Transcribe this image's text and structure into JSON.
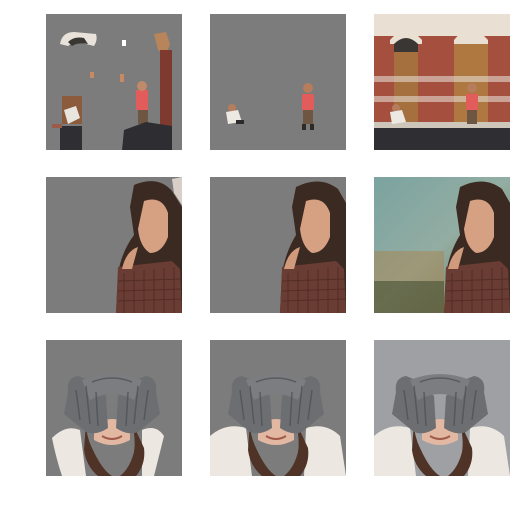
{
  "figure": {
    "rows": [
      {
        "subject": "children-and-doorways",
        "panels": [
          {
            "kind": "partial-segmentation-mask"
          },
          {
            "kind": "refined-segmentation-mask"
          },
          {
            "kind": "original-photo"
          }
        ]
      },
      {
        "subject": "woman-in-plaid-dress",
        "panels": [
          {
            "kind": "partial-segmentation-mask"
          },
          {
            "kind": "refined-segmentation-mask"
          },
          {
            "kind": "original-photo"
          }
        ]
      },
      {
        "subject": "girl-covering-eyes-with-mittens",
        "panels": [
          {
            "kind": "partial-segmentation-mask"
          },
          {
            "kind": "refined-segmentation-mask"
          },
          {
            "kind": "original-photo"
          }
        ]
      }
    ]
  },
  "colors": {
    "mask_background": "#7c7c7c",
    "page_background": "#ffffff"
  }
}
